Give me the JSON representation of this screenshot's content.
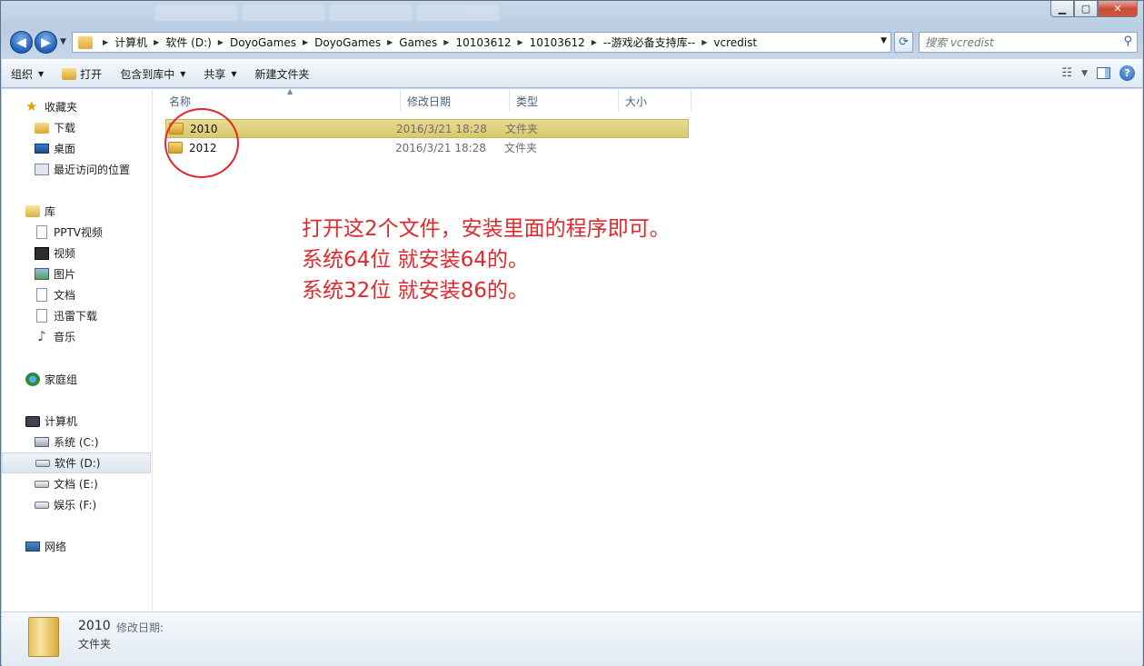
{
  "address": {
    "crumbs": [
      "计算机",
      "软件 (D:)",
      "DoyoGames",
      "DoyoGames",
      "Games",
      "10103612",
      "10103612",
      "--游戏必备支持库--",
      "vcredist"
    ]
  },
  "search": {
    "placeholder": "搜索 vcredist"
  },
  "toolbar": {
    "organize": "组织",
    "open": "打开",
    "include_library": "包含到库中",
    "share": "共享",
    "new_folder": "新建文件夹"
  },
  "nav": {
    "favorites": {
      "label": "收藏夹",
      "items": [
        "下载",
        "桌面",
        "最近访问的位置"
      ]
    },
    "libraries": {
      "label": "库",
      "items": [
        "PPTV视频",
        "视频",
        "图片",
        "文档",
        "迅雷下载",
        "音乐"
      ]
    },
    "homegroup": {
      "label": "家庭组"
    },
    "computer": {
      "label": "计算机",
      "items": [
        "系统 (C:)",
        "软件 (D:)",
        "文档 (E:)",
        "娱乐 (F:)"
      ]
    },
    "network": {
      "label": "网络"
    }
  },
  "columns": [
    "名称",
    "修改日期",
    "类型",
    "大小"
  ],
  "files": [
    {
      "name": "2010",
      "date": "2016/3/21 18:28",
      "type": "文件夹"
    },
    {
      "name": "2012",
      "date": "2016/3/21 18:28",
      "type": "文件夹"
    }
  ],
  "annotation": {
    "lines": [
      "打开这2个文件，安装里面的程序即可。",
      "系统64位 就安装64的。",
      "系统32位 就安装86的。"
    ],
    "color": "#e0292d"
  },
  "details": {
    "name": "2010",
    "modified_label": "修改日期:",
    "type": "文件夹"
  },
  "colors": {
    "selection": "#e3d37c",
    "accent": "#1f5fb5"
  }
}
